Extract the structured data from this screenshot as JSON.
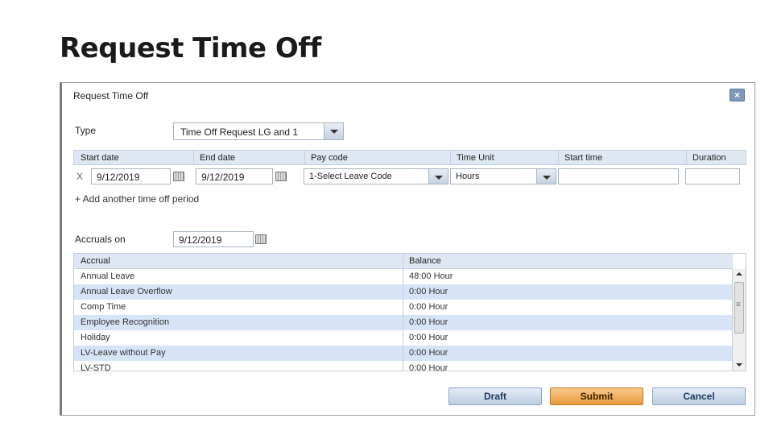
{
  "slide": {
    "title": "Request Time Off"
  },
  "dialog": {
    "title": "Request Time Off",
    "close_symbol": "×",
    "type": {
      "label": "Type",
      "value": "Time Off Request LG and 1"
    },
    "period_grid": {
      "columns": [
        "Start date",
        "End date",
        "Pay code",
        "Time Unit",
        "Start time",
        "Duration"
      ],
      "row": {
        "remove": "X",
        "start_date": "9/12/2019",
        "end_date": "9/12/2019",
        "pay_code": "1-Select Leave Code",
        "time_unit": "Hours",
        "start_time": "",
        "duration": ""
      }
    },
    "add_period": "+ Add another time off period",
    "accruals": {
      "label": "Accruals on",
      "date": "9/12/2019",
      "columns": [
        "Accrual",
        "Balance"
      ],
      "rows": [
        {
          "accrual": "Annual Leave",
          "balance": "48:00 Hour"
        },
        {
          "accrual": "Annual Leave Overflow",
          "balance": "0:00 Hour"
        },
        {
          "accrual": "Comp Time",
          "balance": "0:00 Hour"
        },
        {
          "accrual": "Employee Recognition",
          "balance": "0:00 Hour"
        },
        {
          "accrual": "Holiday",
          "balance": "0:00 Hour"
        },
        {
          "accrual": "LV-Leave without Pay",
          "balance": "0:00 Hour"
        },
        {
          "accrual": "LV-STD",
          "balance": "0:00 Hour"
        }
      ]
    },
    "buttons": {
      "draft": "Draft",
      "submit": "Submit",
      "cancel": "Cancel"
    }
  },
  "colors": {
    "primary_button": "#e99a3e",
    "selected_row": "#d7e4f7",
    "header_bg": "#dfe7f2"
  }
}
